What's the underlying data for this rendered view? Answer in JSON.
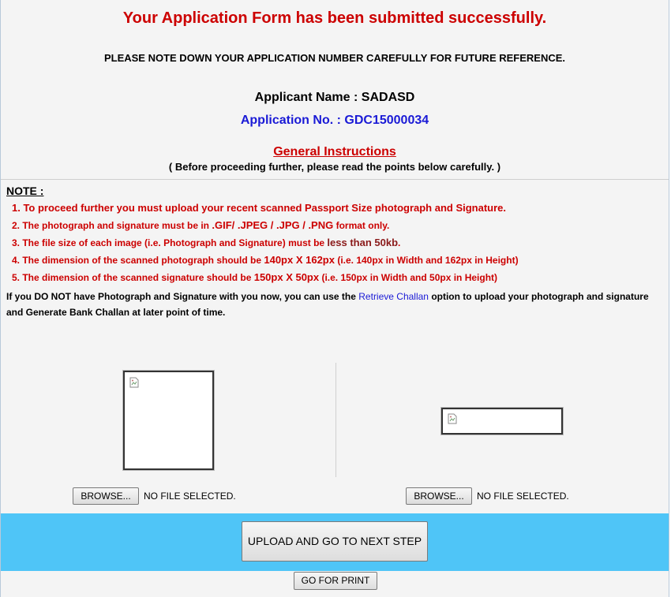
{
  "header": {
    "success_message": "Your Application Form has been submitted successfully.",
    "note_down": "PLEASE NOTE DOWN YOUR APPLICATION NUMBER CAREFULLY FOR FUTURE REFERENCE.",
    "applicant_label": "Applicant Name : ",
    "applicant_name": "SADASD",
    "application_label": "Application No. : ",
    "application_number": "GDC15000034"
  },
  "instructions": {
    "title": "General Instructions",
    "subtitle": "( Before proceeding further, please read the points below carefully. )",
    "note_heading": "NOTE :",
    "items": [
      {
        "text": "1. To proceed further you must upload your recent scanned Passport Size photograph and Signature."
      },
      {
        "pre": "2. The photograph and signature must be in ",
        "emph": ".GIF/ .JPEG / .JPG / .PNG",
        "post": " format only."
      },
      {
        "pre": "3. The file size of each image (i.e. Photograph and Signature) must be ",
        "emph": "less than 50kb",
        "post": "."
      },
      {
        "pre": "4. The dimension of the scanned photograph should be ",
        "emph": "140px X 162px",
        "post": " (i.e. 140px in Width and 162px in Height)"
      },
      {
        "pre": "5. The dimension of the scanned signature should be ",
        "emph": "150px X 50px",
        "post": " (i.e. 150px in Width and 50px in Height)"
      }
    ],
    "info_pre": "If you DO NOT have Photograph and Signature with you now, you can use the ",
    "info_link": "Retrieve Challan",
    "info_post": " option to upload your photograph and signature and Generate Bank Challan at later point of time."
  },
  "upload": {
    "photo": {
      "browse_label": "BROWSE...",
      "status": "NO FILE SELECTED."
    },
    "signature": {
      "browse_label": "BROWSE...",
      "status": "NO FILE SELECTED."
    }
  },
  "actions": {
    "upload_next": "UPLOAD AND GO TO NEXT STEP",
    "print": "GO FOR PRINT"
  },
  "colors": {
    "success_red": "#cc0000",
    "application_blue": "#1a1ad6",
    "action_band": "#4fc5f7"
  },
  "icons": {
    "photo_placeholder": "broken-image-icon",
    "signature_placeholder": "broken-image-icon"
  }
}
